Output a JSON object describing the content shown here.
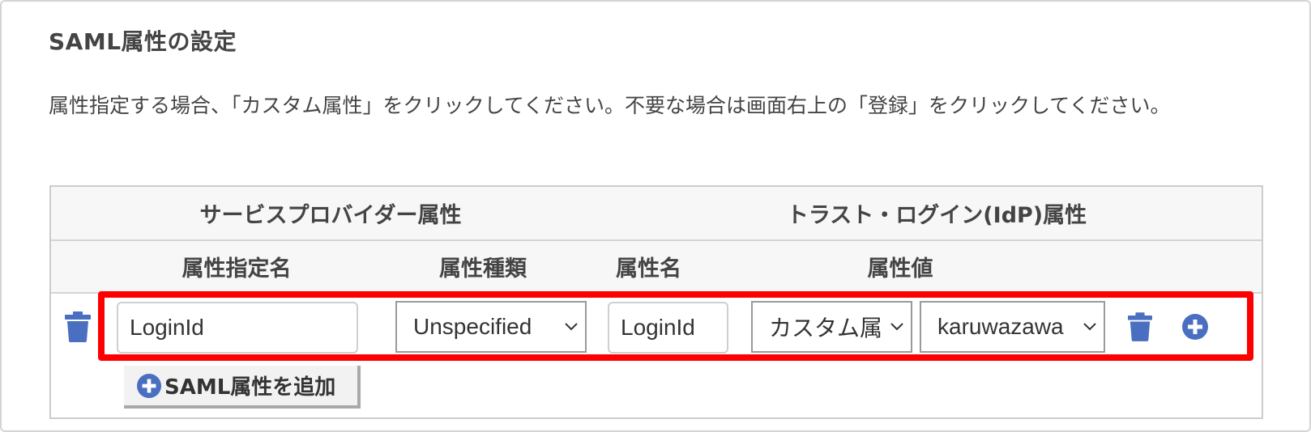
{
  "section": {
    "title": "SAML属性の設定",
    "description": "属性指定する場合、「カスタム属性」をクリックしてください。不要な場合は画面右上の「登録」をクリックしてください。"
  },
  "table": {
    "group_headers": {
      "service_provider": "サービスプロバイダー属性",
      "idp": "トラスト・ログイン(IdP)属性"
    },
    "column_headers": {
      "attr_designation": "属性指定名",
      "attr_type": "属性種類",
      "attr_name": "属性名",
      "attr_value": "属性値"
    },
    "rows": [
      {
        "attr_designation_value": "LoginId",
        "attr_type_selected": "Unspecified",
        "attr_name_value": "LoginId",
        "value_source_selected": "カスタム属性",
        "value_selected": "karuwazawa"
      }
    ]
  },
  "add_button_label": "SAML属性を追加",
  "icons": {
    "delete": "trash-icon",
    "add": "plus-circle-icon",
    "dropdown": "chevron-down-icon"
  },
  "colors": {
    "icon_blue": "#4a6fc1",
    "highlight_red": "#ff0000"
  }
}
